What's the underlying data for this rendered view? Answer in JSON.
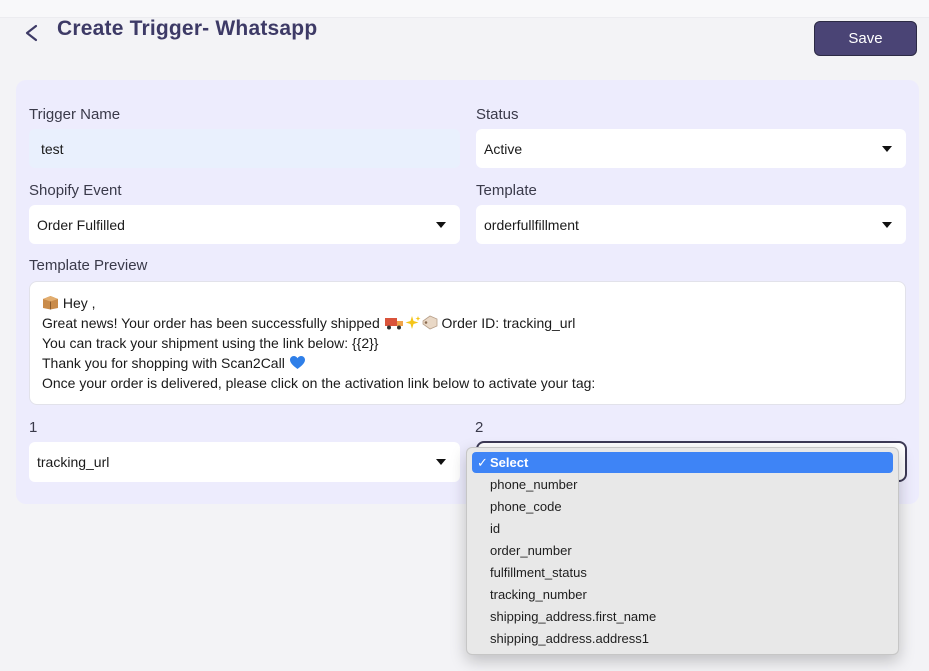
{
  "header": {
    "title": "Create Trigger- Whatsapp",
    "save_label": "Save"
  },
  "form": {
    "trigger_name_label": "Trigger Name",
    "trigger_name_value": "test",
    "status_label": "Status",
    "status_value": "Active",
    "shopify_event_label": "Shopify Event",
    "shopify_event_value": "Order Fulfilled",
    "template_label": "Template",
    "template_value": "orderfullfillment",
    "preview_label": "Template Preview",
    "preview_lines": [
      " Hey ,",
      "Great news! Your order has been successfully shipped ",
      " Order ID:  tracking_url",
      "You can track your shipment using the link below: {{2}}",
      "Thank you for shopping with Scan2Call ",
      "Once your order is delivered, please click on the activation link below to activate your tag:"
    ],
    "var1_label": "1",
    "var1_value": "tracking_url",
    "var2_label": "2"
  },
  "dropdown": {
    "options": [
      "Select",
      "phone_number",
      "phone_code",
      "id",
      "order_number",
      "fulfillment_status",
      "tracking_number",
      "shipping_address.first_name",
      "shipping_address.address1"
    ],
    "selected_index": 0
  },
  "icons": {
    "back": "chevron-left-icon",
    "package": "package-emoji",
    "truck": "truck-emoji",
    "sparkles": "sparkles-emoji",
    "tag": "tag-emoji",
    "heart": "blue-heart-emoji"
  },
  "colors": {
    "title": "#3d3a66",
    "save_button": "#4a4475",
    "card_bg": "#edecfd",
    "selected_option": "#3e84f6"
  }
}
